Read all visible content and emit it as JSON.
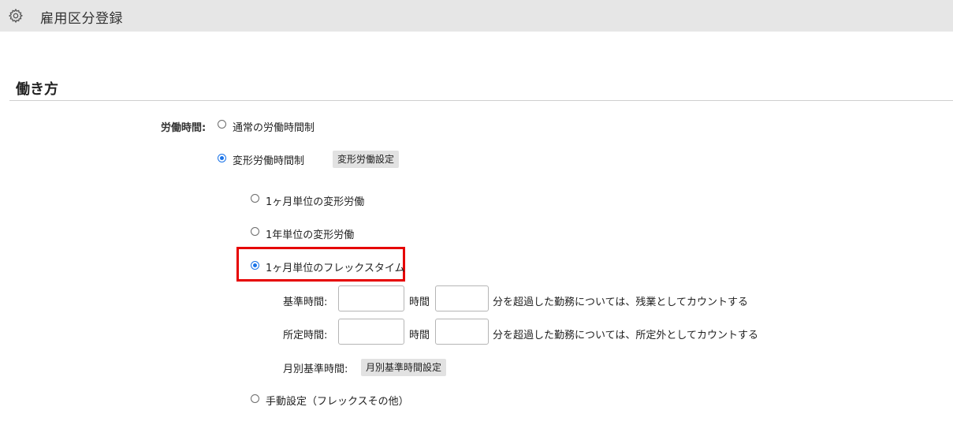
{
  "header": {
    "title": "雇用区分登録",
    "icon": "gear-icon"
  },
  "section": {
    "title": "働き方"
  },
  "labor_time": {
    "label": "労働時間:",
    "options": [
      {
        "label": "通常の労働時間制",
        "selected": false
      },
      {
        "label": "変形労働時間制",
        "selected": true,
        "button": "変形労働設定"
      }
    ],
    "sub_options": [
      {
        "label": "1ヶ月単位の変形労働",
        "selected": false
      },
      {
        "label": "1年単位の変形労働",
        "selected": false
      },
      {
        "label": "1ヶ月単位のフレックスタイム",
        "selected": true
      },
      {
        "label": "手動設定（フレックスその他）",
        "selected": false
      }
    ],
    "flex": {
      "standard_label": "基準時間:",
      "standard_hours": "",
      "standard_minutes": "",
      "standard_desc": "分を超過した勤務については、残業としてカウントする",
      "scheduled_label": "所定時間:",
      "scheduled_hours": "",
      "scheduled_minutes": "",
      "scheduled_desc": "分を超過した勤務については、所定外としてカウントする",
      "hours_unit": "時間",
      "monthly_label": "月別基準時間:",
      "monthly_button": "月別基準時間設定"
    }
  },
  "colors": {
    "accent": "#1a73e8",
    "highlight": "#e60000",
    "header_bg": "#e6e6e6"
  }
}
